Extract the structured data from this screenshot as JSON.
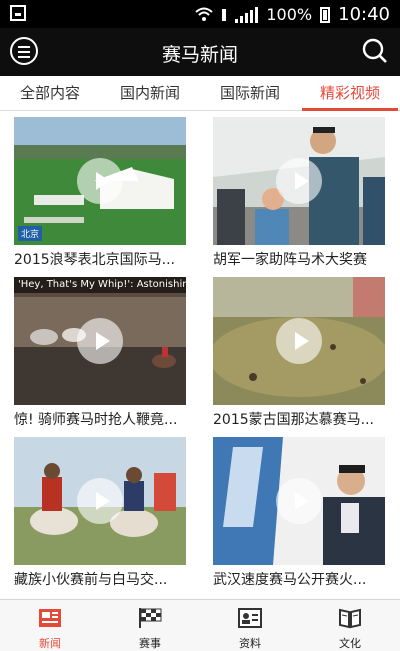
{
  "status": {
    "battery": "100%",
    "time": "10:40"
  },
  "header": {
    "title": "赛马新闻"
  },
  "tabs": [
    {
      "label": "全部内容",
      "active": false
    },
    {
      "label": "国内新闻",
      "active": false
    },
    {
      "label": "国际新闻",
      "active": false
    },
    {
      "label": "精彩视频",
      "active": true
    }
  ],
  "videos": [
    {
      "caption": "2015浪琴表北京国际马...",
      "badge": "北京"
    },
    {
      "caption": "胡军一家助阵马术大奖赛"
    },
    {
      "caption": "惊! 骑师赛马时抢人鞭竟...",
      "overlay": "'Hey, That's My Whip!': Astonishing Str..."
    },
    {
      "caption": "2015蒙古国那达慕赛马..."
    },
    {
      "caption": "藏族小伙赛前与白马交..."
    },
    {
      "caption": "武汉速度赛马公开赛火..."
    }
  ],
  "bottom_nav": [
    {
      "label": "新闻",
      "active": true,
      "icon": "news-icon"
    },
    {
      "label": "赛事",
      "active": false,
      "icon": "checkered-flag-icon"
    },
    {
      "label": "资料",
      "active": false,
      "icon": "profile-card-icon"
    },
    {
      "label": "文化",
      "active": false,
      "icon": "book-icon"
    }
  ],
  "colors": {
    "accent": "#e24b3a",
    "topbar": "#0e0e0e"
  }
}
